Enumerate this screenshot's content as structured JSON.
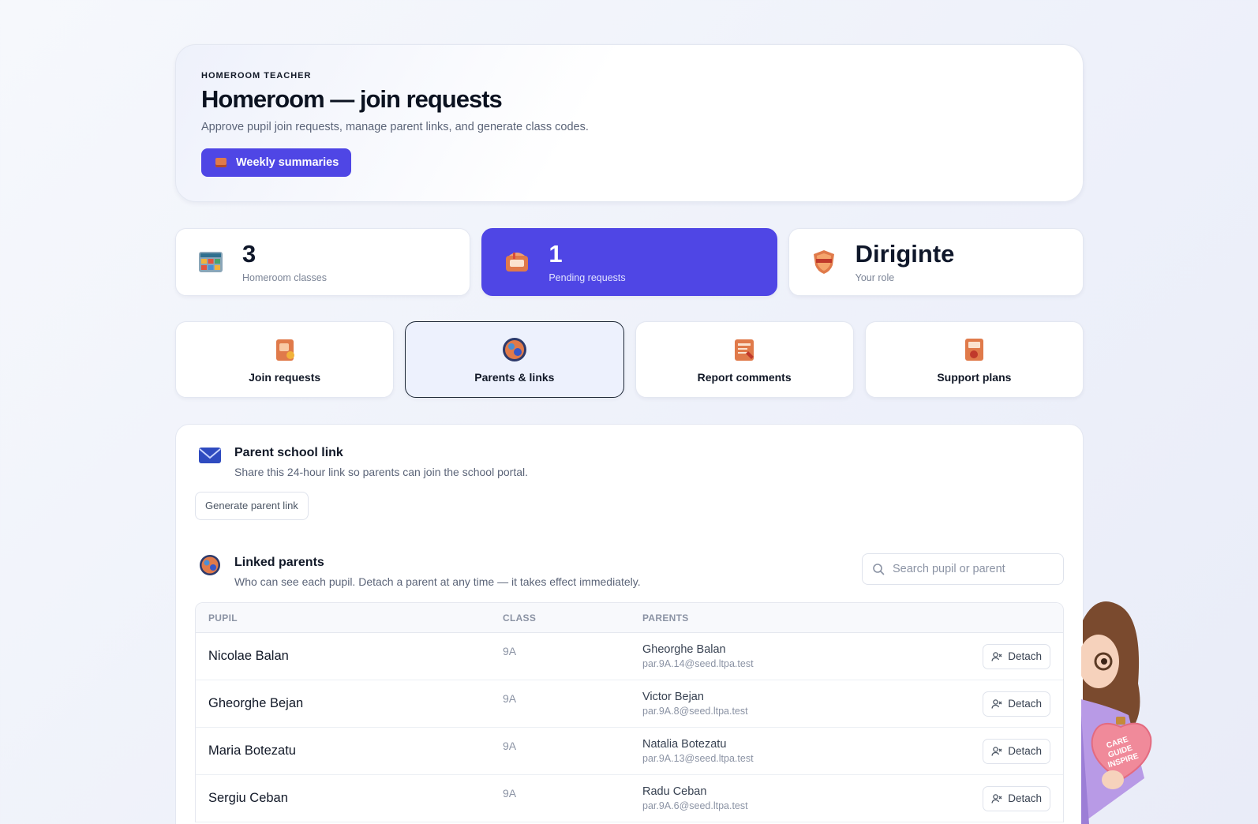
{
  "hero": {
    "eyebrow": "HOMEROOM TEACHER",
    "title": "Homeroom — join requests",
    "subtitle": "Approve pupil join requests, manage parent links, and generate class codes.",
    "weekly_button": "Weekly summaries"
  },
  "stats": [
    {
      "value": "3",
      "label": "Homeroom classes",
      "icon": "classes-board-icon"
    },
    {
      "value": "1",
      "label": "Pending requests",
      "icon": "mailbox-icon"
    },
    {
      "value": "Diriginte",
      "label": "Your role",
      "icon": "shield-badge-icon"
    }
  ],
  "tabs": [
    {
      "label": "Join requests",
      "icon": "join-book-icon"
    },
    {
      "label": "Parents & links",
      "icon": "parents-globe-icon"
    },
    {
      "label": "Report comments",
      "icon": "report-clipboard-icon"
    },
    {
      "label": "Support plans",
      "icon": "support-plan-icon"
    }
  ],
  "parent_link": {
    "title": "Parent school link",
    "description": "Share this 24-hour link so parents can join the school portal.",
    "button": "Generate parent link"
  },
  "linked_parents": {
    "title": "Linked parents",
    "description": "Who can see each pupil. Detach a parent at any time — it takes effect immediately.",
    "search_placeholder": "Search pupil or parent",
    "columns": [
      "PUPIL",
      "CLASS",
      "PARENTS"
    ],
    "detach_label": "Detach",
    "rows": [
      {
        "pupil": "Nicolae Balan",
        "class": "9A",
        "parent": "Gheorghe Balan",
        "email": "par.9A.14@seed.ltpa.test"
      },
      {
        "pupil": "Gheorghe Bejan",
        "class": "9A",
        "parent": "Victor Bejan",
        "email": "par.9A.8@seed.ltpa.test"
      },
      {
        "pupil": "Maria Botezatu",
        "class": "9A",
        "parent": "Natalia Botezatu",
        "email": "par.9A.13@seed.ltpa.test"
      },
      {
        "pupil": "Sergiu Ceban",
        "class": "9A",
        "parent": "Radu Ceban",
        "email": "par.9A.6@seed.ltpa.test"
      }
    ]
  },
  "mascot": {
    "sign": [
      "CARE",
      "GUIDE",
      "INSPIRE"
    ]
  },
  "colors": {
    "accent": "#4f46e5",
    "icon_orange": "#e07a4a"
  }
}
